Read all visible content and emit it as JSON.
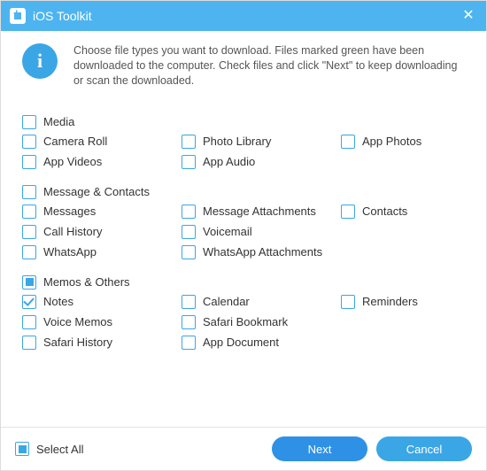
{
  "window": {
    "title": "iOS Toolkit",
    "close_glyph": "✕"
  },
  "intro": {
    "info_glyph": "i",
    "text": "Choose file types you want to download. Files marked green have been downloaded to the computer. Check files and click \"Next\" to keep downloading or scan the downloaded."
  },
  "sections": [
    {
      "name": "media",
      "header": "Media",
      "header_state": "unchecked",
      "rows": [
        [
          {
            "id": "camera-roll",
            "label": "Camera Roll",
            "state": "unchecked"
          },
          {
            "id": "photo-library",
            "label": "Photo Library",
            "state": "unchecked"
          },
          {
            "id": "app-photos",
            "label": "App Photos",
            "state": "unchecked"
          }
        ],
        [
          {
            "id": "app-videos",
            "label": "App Videos",
            "state": "unchecked"
          },
          {
            "id": "app-audio",
            "label": "App Audio",
            "state": "unchecked"
          }
        ]
      ]
    },
    {
      "name": "message-contacts",
      "header": "Message & Contacts",
      "header_state": "unchecked",
      "rows": [
        [
          {
            "id": "messages",
            "label": "Messages",
            "state": "unchecked"
          },
          {
            "id": "message-attachments",
            "label": "Message Attachments",
            "state": "unchecked"
          },
          {
            "id": "contacts",
            "label": "Contacts",
            "state": "unchecked"
          }
        ],
        [
          {
            "id": "call-history",
            "label": "Call History",
            "state": "unchecked"
          },
          {
            "id": "voicemail",
            "label": "Voicemail",
            "state": "unchecked"
          }
        ],
        [
          {
            "id": "whatsapp",
            "label": "WhatsApp",
            "state": "unchecked"
          },
          {
            "id": "whatsapp-attachments",
            "label": "WhatsApp Attachments",
            "state": "unchecked"
          }
        ]
      ]
    },
    {
      "name": "memos-others",
      "header": "Memos & Others",
      "header_state": "partial",
      "rows": [
        [
          {
            "id": "notes",
            "label": "Notes",
            "state": "checked"
          },
          {
            "id": "calendar",
            "label": "Calendar",
            "state": "unchecked"
          },
          {
            "id": "reminders",
            "label": "Reminders",
            "state": "unchecked"
          }
        ],
        [
          {
            "id": "voice-memos",
            "label": "Voice Memos",
            "state": "unchecked"
          },
          {
            "id": "safari-bookmark",
            "label": "Safari Bookmark",
            "state": "unchecked"
          }
        ],
        [
          {
            "id": "safari-history",
            "label": "Safari History",
            "state": "unchecked"
          },
          {
            "id": "app-document",
            "label": "App Document",
            "state": "unchecked"
          }
        ]
      ]
    }
  ],
  "footer": {
    "select_all": {
      "label": "Select All",
      "state": "partial"
    },
    "next": "Next",
    "cancel": "Cancel"
  }
}
